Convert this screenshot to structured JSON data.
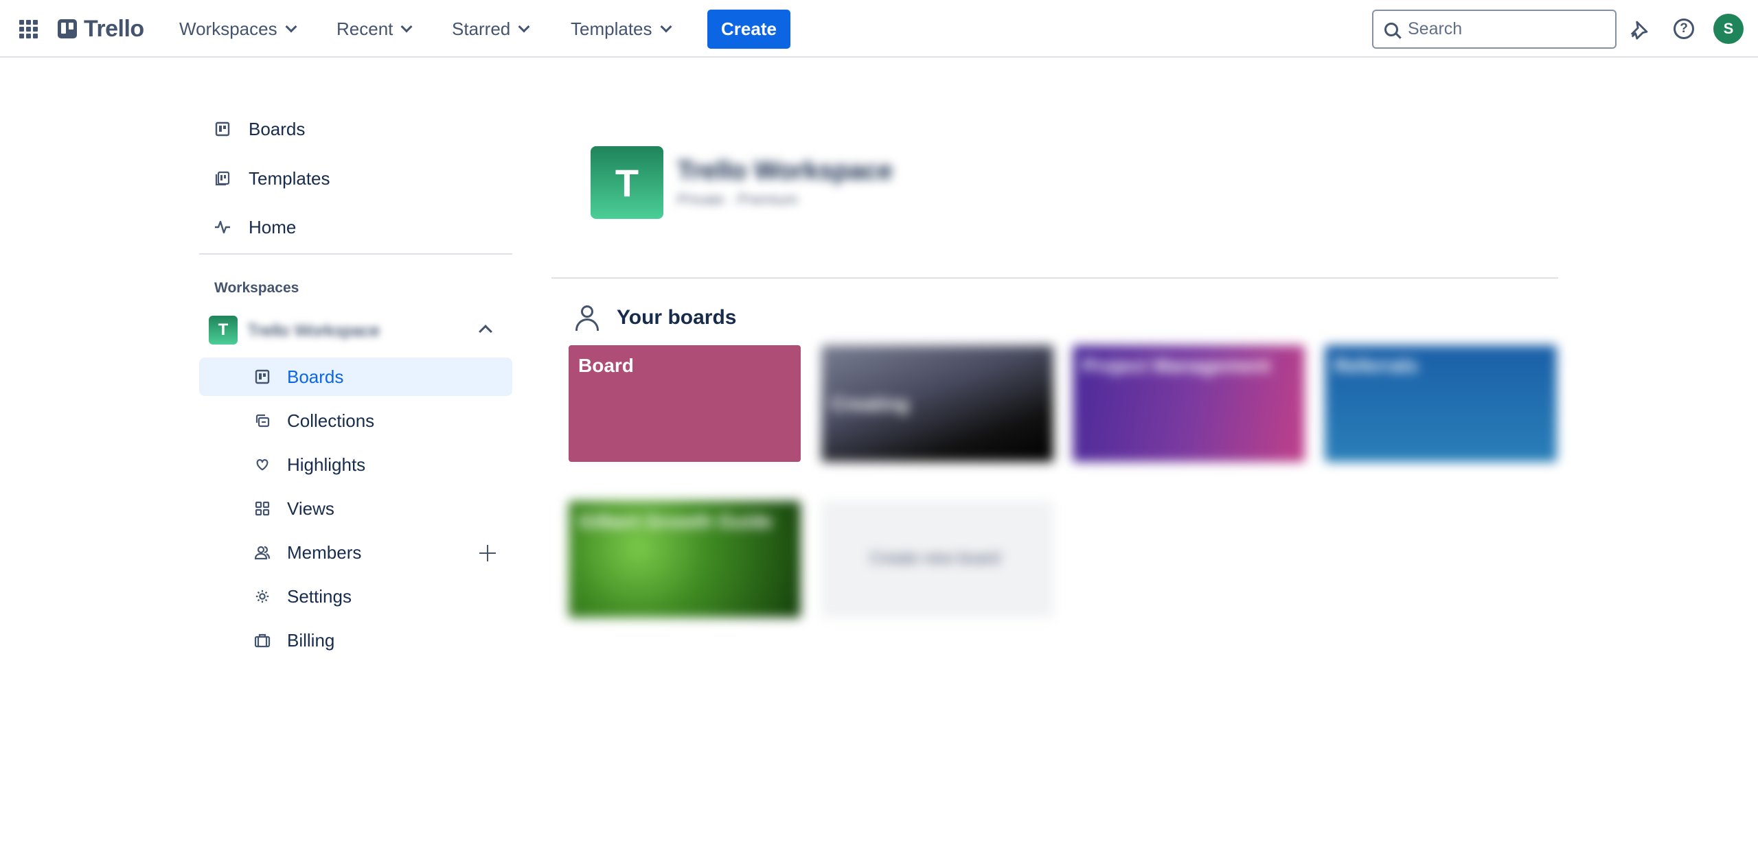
{
  "header": {
    "logo_text": "Trello",
    "nav": [
      {
        "label": "Workspaces"
      },
      {
        "label": "Recent"
      },
      {
        "label": "Starred"
      },
      {
        "label": "Templates"
      }
    ],
    "create_label": "Create",
    "search_placeholder": "Search",
    "avatar_initial": "S"
  },
  "sidebar": {
    "top_items": [
      {
        "label": "Boards",
        "icon": "board-icon"
      },
      {
        "label": "Templates",
        "icon": "template-icon"
      },
      {
        "label": "Home",
        "icon": "activity-icon"
      }
    ],
    "workspaces_heading": "Workspaces",
    "workspace": {
      "initial": "T",
      "name": "Trello Workspace"
    },
    "sub_items": [
      {
        "label": "Boards",
        "icon": "board-icon",
        "active": true
      },
      {
        "label": "Collections",
        "icon": "collections-icon"
      },
      {
        "label": "Highlights",
        "icon": "heart-icon"
      },
      {
        "label": "Views",
        "icon": "grid-icon"
      },
      {
        "label": "Members",
        "icon": "members-icon"
      },
      {
        "label": "Settings",
        "icon": "gear-icon"
      },
      {
        "label": "Billing",
        "icon": "briefcase-icon"
      }
    ]
  },
  "main": {
    "workspace_initial": "T",
    "workspace_title": "Trello Workspace",
    "workspace_meta": "Private · Premium",
    "your_boards_title": "Your boards",
    "boards": [
      {
        "label": "Board",
        "color": "#ae4d76"
      },
      {
        "label": "Creating"
      },
      {
        "label": "Project Management"
      },
      {
        "label": "Referrals"
      },
      {
        "label": "Gilbert Growth Guide"
      }
    ],
    "create_board_label": "Create new board"
  },
  "colors": {
    "accent": "#0c66e4",
    "workspace_green": "#1f845a",
    "active_bg": "#e9f2ff"
  }
}
